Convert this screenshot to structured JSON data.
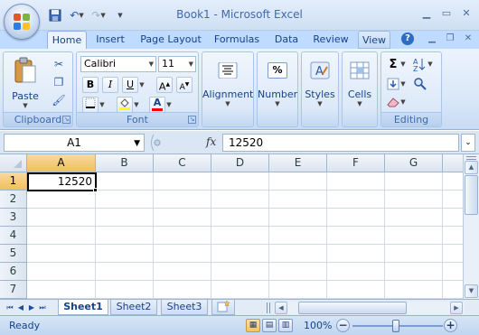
{
  "window": {
    "title": "Book1 - Microsoft Excel"
  },
  "ribbon": {
    "tabs": [
      "Home",
      "Insert",
      "Page Layout",
      "Formulas",
      "Data",
      "Review",
      "View"
    ],
    "active_tab": "Home",
    "clipboard": {
      "paste_label": "Paste",
      "group_label": "Clipboard"
    },
    "font": {
      "font_name": "Calibri",
      "font_size": "11",
      "group_label": "Font",
      "bold": "B",
      "italic": "I",
      "underline": "U",
      "grow": "A",
      "shrink": "A",
      "font_color_letter": "A",
      "fill_color": "#ffff00",
      "font_color": "#ff0000"
    },
    "alignment": {
      "label": "Alignment"
    },
    "number": {
      "label": "Number",
      "icon_text": "%"
    },
    "styles": {
      "label": "Styles"
    },
    "cells": {
      "label": "Cells"
    },
    "editing": {
      "group_label": "Editing",
      "sum_symbol": "Σ"
    }
  },
  "formula_bar": {
    "name_box": "A1",
    "fx": "fx",
    "value": "12520"
  },
  "grid": {
    "columns": [
      "A",
      "B",
      "C",
      "D",
      "E",
      "F",
      "G"
    ],
    "rows": [
      "1",
      "2",
      "3",
      "4",
      "5",
      "6",
      "7"
    ],
    "active_cell": {
      "ref": "A1",
      "value": "12520"
    }
  },
  "sheets": {
    "tabs": [
      "Sheet1",
      "Sheet2",
      "Sheet3"
    ],
    "active": "Sheet1"
  },
  "status": {
    "text": "Ready",
    "zoom": "100%"
  },
  "colors": {
    "accent": "#15428b",
    "ribbon_bg": "#dbe8f8",
    "selected_header": "#f1c05c"
  }
}
